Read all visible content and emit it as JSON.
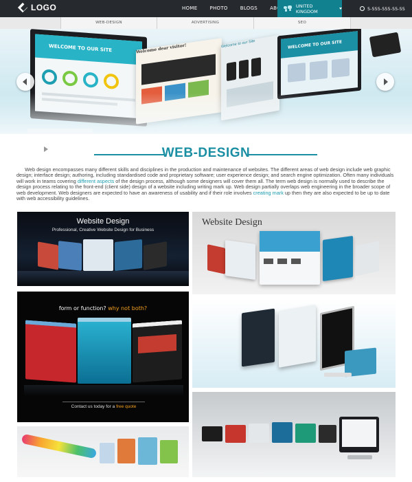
{
  "header": {
    "logo": "LOGO",
    "nav": [
      "HOME",
      "PHOTO",
      "BLOGS",
      "ABOUT US"
    ],
    "language": "UNITED KINGDOM",
    "phone": "5-555-555-55-55"
  },
  "subnav": [
    "WEB-DESIGN",
    "ADVERTISING",
    "SEO"
  ],
  "hero": {
    "screen1_title": "WELCOME TO OUR SITE",
    "screen2_title": "Welcome dear visitor!",
    "screen3_title": "Welcome to our Site",
    "screen4_title": "WELCOME TO OUR SITE"
  },
  "section": {
    "title": "WEB-DESIGN",
    "intro_lead": "Web design encompasses many different skills and disciplines in the production and maintenance of websites. The different areas of web design include web graphic design; interface design; authoring, including standardised code and proprietary software; user experience design; and search engine optimization. Often many individuals will work in teams covering ",
    "intro_link1": "different aspects",
    "intro_mid": " of the design process, although some designers will cover them all. The term web design is normally used to describe the design process relating to the front-end (client side) design of a website including writing mark up. Web design partially overlaps web engineering in the broader scope of web development. Web designers are expected to have an awareness of usability and if their role involves ",
    "intro_link2": "creating mark",
    "intro_end": " up then they are also expected to be up to date with web accessibility guidelines."
  },
  "gallery": {
    "tile1_title": "Website Design",
    "tile1_sub": "Professional, Creative Website Design for Business",
    "tile2_title": "Website Design",
    "tile3_question": "form or function?",
    "tile3_answer": "why not both?",
    "tile3_contact": "Contact us today for a",
    "tile3_quote": "free quote"
  },
  "colors": {
    "accent": "#1a8ea3",
    "topbar": "#262a2e",
    "language_bg": "#11808f"
  }
}
